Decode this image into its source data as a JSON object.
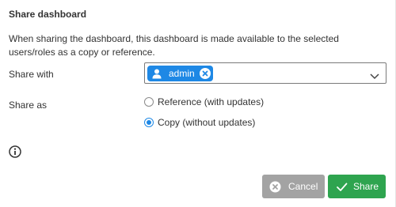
{
  "dialog": {
    "title": "Share dashboard",
    "description": "When sharing the dashboard, this dashboard is made available to the selected users/roles as a copy or reference."
  },
  "share_with": {
    "label": "Share with",
    "selected": [
      {
        "label": "admin",
        "icon": "user-icon"
      }
    ]
  },
  "share_as": {
    "label": "Share as",
    "options": [
      {
        "label": "Reference (with updates)",
        "checked": false
      },
      {
        "label": "Copy (without updates)",
        "checked": true
      }
    ]
  },
  "buttons": {
    "cancel_label": "Cancel",
    "share_label": "Share"
  },
  "colors": {
    "accent": "#1e88e5",
    "share_button": "#2ea44f",
    "cancel_button": "#a3a3a3"
  }
}
